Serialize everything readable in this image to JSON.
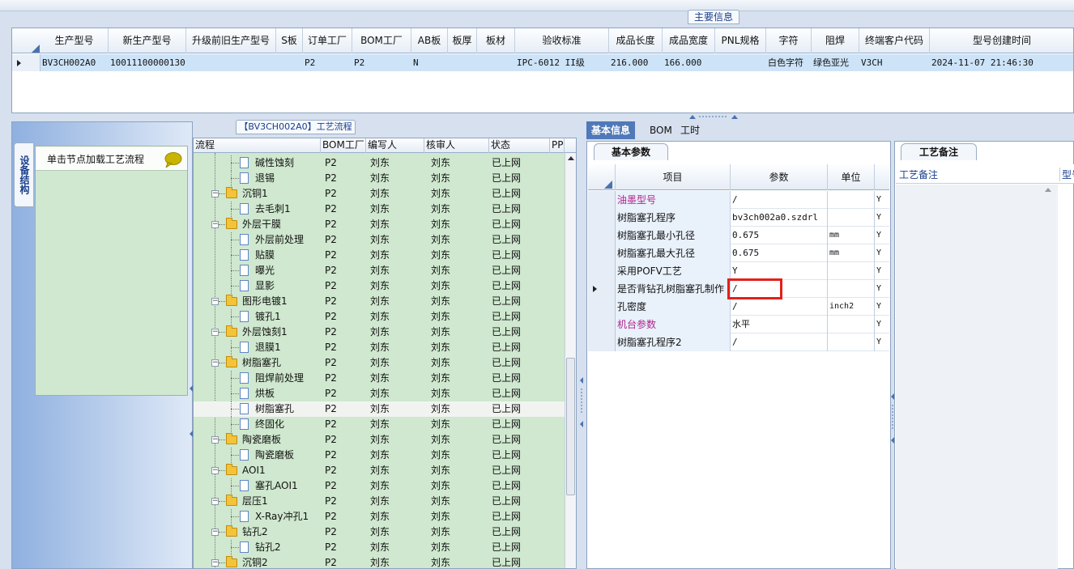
{
  "main_info": {
    "group_title": "主要信息",
    "columns": [
      "生产型号",
      "新生产型号",
      "升级前旧生产型号",
      "S板",
      "订单工厂",
      "BOM工厂",
      "AB板",
      "板厚",
      "板材",
      "验收标准",
      "成品长度",
      "成品宽度",
      "PNL规格",
      "字符",
      "阻焊",
      "终端客户代码",
      "型号创建时间"
    ],
    "row": [
      "BV3CH002A0",
      "10011100000130",
      "",
      "",
      "P2",
      "P2",
      "N",
      "",
      "",
      "IPC-6012 II级",
      "216.000",
      "166.000",
      "",
      "白色字符",
      "绿色亚光",
      "V3CH",
      "2024-11-07 21:46:30"
    ]
  },
  "side_tab": "设备结构",
  "node_panel": {
    "header": "单击节点加载工艺流程"
  },
  "tree": {
    "title": "【BV3CH002A0】工艺流程",
    "columns": [
      "流程",
      "BOM工厂",
      "编写人",
      "核审人",
      "状态",
      "PP"
    ],
    "rows": [
      {
        "level": 2,
        "type": "doc",
        "name": "碱性蚀刻",
        "bom": "P2",
        "writer": "刘东",
        "reviewer": "刘东",
        "status": "已上网"
      },
      {
        "level": 2,
        "type": "doc",
        "name": "退锡",
        "bom": "P2",
        "writer": "刘东",
        "reviewer": "刘东",
        "status": "已上网"
      },
      {
        "level": 1,
        "type": "folder",
        "name": "沉铜1",
        "bom": "P2",
        "writer": "刘东",
        "reviewer": "刘东",
        "status": "已上网"
      },
      {
        "level": 2,
        "type": "doc",
        "name": "去毛刺1",
        "bom": "P2",
        "writer": "刘东",
        "reviewer": "刘东",
        "status": "已上网"
      },
      {
        "level": 1,
        "type": "folder",
        "name": "外层干膜",
        "bom": "P2",
        "writer": "刘东",
        "reviewer": "刘东",
        "status": "已上网"
      },
      {
        "level": 2,
        "type": "doc",
        "name": "外层前处理",
        "bom": "P2",
        "writer": "刘东",
        "reviewer": "刘东",
        "status": "已上网"
      },
      {
        "level": 2,
        "type": "doc",
        "name": "贴膜",
        "bom": "P2",
        "writer": "刘东",
        "reviewer": "刘东",
        "status": "已上网"
      },
      {
        "level": 2,
        "type": "doc",
        "name": "曝光",
        "bom": "P2",
        "writer": "刘东",
        "reviewer": "刘东",
        "status": "已上网"
      },
      {
        "level": 2,
        "type": "doc",
        "name": "显影",
        "bom": "P2",
        "writer": "刘东",
        "reviewer": "刘东",
        "status": "已上网"
      },
      {
        "level": 1,
        "type": "folder",
        "name": "图形电镀1",
        "bom": "P2",
        "writer": "刘东",
        "reviewer": "刘东",
        "status": "已上网"
      },
      {
        "level": 2,
        "type": "doc",
        "name": "镀孔1",
        "bom": "P2",
        "writer": "刘东",
        "reviewer": "刘东",
        "status": "已上网"
      },
      {
        "level": 1,
        "type": "folder",
        "name": "外层蚀刻1",
        "bom": "P2",
        "writer": "刘东",
        "reviewer": "刘东",
        "status": "已上网"
      },
      {
        "level": 2,
        "type": "doc",
        "name": "退膜1",
        "bom": "P2",
        "writer": "刘东",
        "reviewer": "刘东",
        "status": "已上网"
      },
      {
        "level": 1,
        "type": "folder",
        "name": "树脂塞孔",
        "bom": "P2",
        "writer": "刘东",
        "reviewer": "刘东",
        "status": "已上网"
      },
      {
        "level": 2,
        "type": "doc",
        "name": "阻焊前处理",
        "bom": "P2",
        "writer": "刘东",
        "reviewer": "刘东",
        "status": "已上网"
      },
      {
        "level": 2,
        "type": "doc",
        "name": "烘板",
        "bom": "P2",
        "writer": "刘东",
        "reviewer": "刘东",
        "status": "已上网"
      },
      {
        "level": 2,
        "type": "doc",
        "name": "树脂塞孔",
        "bom": "P2",
        "writer": "刘东",
        "reviewer": "刘东",
        "status": "已上网",
        "selected": true
      },
      {
        "level": 2,
        "type": "doc",
        "name": "终固化",
        "bom": "P2",
        "writer": "刘东",
        "reviewer": "刘东",
        "status": "已上网"
      },
      {
        "level": 1,
        "type": "folder",
        "name": "陶瓷磨板",
        "bom": "P2",
        "writer": "刘东",
        "reviewer": "刘东",
        "status": "已上网"
      },
      {
        "level": 2,
        "type": "doc",
        "name": "陶瓷磨板",
        "bom": "P2",
        "writer": "刘东",
        "reviewer": "刘东",
        "status": "已上网"
      },
      {
        "level": 1,
        "type": "folder",
        "name": "AOI1",
        "bom": "P2",
        "writer": "刘东",
        "reviewer": "刘东",
        "status": "已上网"
      },
      {
        "level": 2,
        "type": "doc",
        "name": "塞孔AOI1",
        "bom": "P2",
        "writer": "刘东",
        "reviewer": "刘东",
        "status": "已上网"
      },
      {
        "level": 1,
        "type": "folder",
        "name": "层压1",
        "bom": "P2",
        "writer": "刘东",
        "reviewer": "刘东",
        "status": "已上网"
      },
      {
        "level": 2,
        "type": "doc",
        "name": "X-Ray冲孔1",
        "bom": "P2",
        "writer": "刘东",
        "reviewer": "刘东",
        "status": "已上网"
      },
      {
        "level": 1,
        "type": "folder",
        "name": "钻孔2",
        "bom": "P2",
        "writer": "刘东",
        "reviewer": "刘东",
        "status": "已上网"
      },
      {
        "level": 2,
        "type": "doc",
        "name": "钻孔2",
        "bom": "P2",
        "writer": "刘东",
        "reviewer": "刘东",
        "status": "已上网"
      },
      {
        "level": 1,
        "type": "folder",
        "name": "沉铜2",
        "bom": "P2",
        "writer": "刘东",
        "reviewer": "刘东",
        "status": "已上网"
      }
    ]
  },
  "right_tabs": [
    "基本信息",
    "BOM",
    "工时"
  ],
  "basic_params": {
    "tab": "基本参数",
    "columns": [
      "项目",
      "参数",
      "单位"
    ],
    "rows": [
      {
        "item": "油墨型号",
        "value": "/",
        "unit": "",
        "flag": "Y",
        "magenta": true
      },
      {
        "item": "树脂塞孔程序",
        "value": "bv3ch002a0.szdrl",
        "unit": "",
        "flag": "Y"
      },
      {
        "item": "树脂塞孔最小孔径",
        "value": "0.675",
        "unit": "mm",
        "flag": "Y"
      },
      {
        "item": "树脂塞孔最大孔径",
        "value": "0.675",
        "unit": "mm",
        "flag": "Y"
      },
      {
        "item": "采用POFV工艺",
        "value": "Y",
        "unit": "",
        "flag": "Y"
      },
      {
        "item": "是否背钻孔树脂塞孔制作",
        "value": "/",
        "unit": "",
        "flag": "Y",
        "current": true
      },
      {
        "item": "孔密度",
        "value": "/",
        "unit": "inch2",
        "flag": "Y"
      },
      {
        "item": "机台参数",
        "value": "水平",
        "unit": "",
        "flag": "Y",
        "magenta": true
      },
      {
        "item": "树脂塞孔程序2",
        "value": "/",
        "unit": "",
        "flag": "Y"
      }
    ]
  },
  "notes": {
    "tab": "工艺备注",
    "columns": [
      "工艺备注",
      "型号"
    ]
  },
  "colors": {
    "accent": "#4f79b8",
    "tree_bg": "#cfe8cf",
    "highlight": "#e3201b",
    "selected_row": "#cde3f8"
  }
}
